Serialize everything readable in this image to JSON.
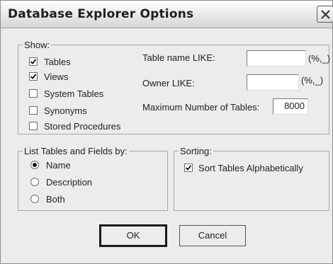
{
  "window": {
    "title": "Database Explorer Options"
  },
  "show": {
    "label": "Show:",
    "checkboxes": [
      {
        "label": "Tables",
        "checked": true
      },
      {
        "label": "Views",
        "checked": true
      },
      {
        "label": "System Tables",
        "checked": false
      },
      {
        "label": "Synonyms",
        "checked": false
      },
      {
        "label": "Stored Procedures",
        "checked": false
      }
    ],
    "table_name_like": {
      "label": "Table name LIKE:",
      "value": "",
      "suffix": "(%,_)"
    },
    "owner_like": {
      "label": "Owner LIKE:",
      "value": "",
      "suffix": "(%,_)"
    },
    "max_tables": {
      "label": "Maximum Number of Tables:",
      "value": "8000"
    }
  },
  "list_by": {
    "label": "List Tables and Fields by:",
    "options": [
      {
        "label": "Name",
        "selected": true
      },
      {
        "label": "Description",
        "selected": false
      },
      {
        "label": "Both",
        "selected": false
      }
    ]
  },
  "sorting": {
    "label": "Sorting:",
    "checkbox": {
      "label": "Sort Tables Alphabetically",
      "checked": true
    }
  },
  "buttons": {
    "ok": "OK",
    "cancel": "Cancel"
  }
}
